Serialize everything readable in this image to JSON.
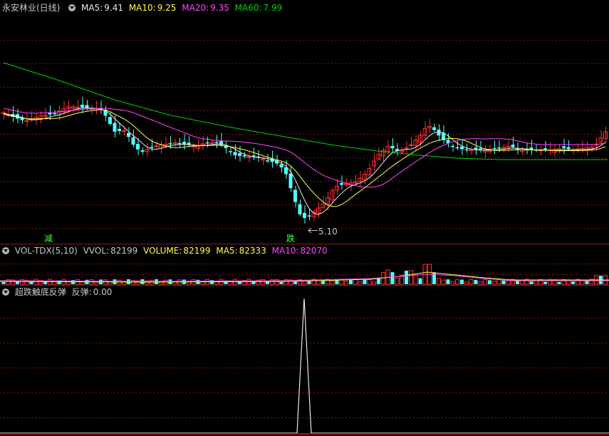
{
  "main_header": {
    "stock_label": "永安林业(日线)",
    "ma5_label": "MA5:",
    "ma5_value": "9.41",
    "ma10_label": "MA10:",
    "ma10_value": "9.25",
    "ma20_label": "MA20:",
    "ma20_value": "9.35",
    "ma60_label": "MA60:",
    "ma60_value": "7.99"
  },
  "vol_header": {
    "indicator_label": "VOL-TDX(5,10)",
    "vvol_label": "VVOL:",
    "vvol_value": "82199",
    "volume_label": "VOLUME:",
    "volume_value": "82199",
    "ma5_label": "MA5:",
    "ma5_value": "82333",
    "ma10_label": "MA10:",
    "ma10_value": "82070"
  },
  "sub_header": {
    "indicator_label": "超跌触底反弹",
    "value_label": "反弹:",
    "value": "0.00"
  },
  "annotations": {
    "marker_jian": "减",
    "marker_die": "跌",
    "low_price": "5.10"
  },
  "colors": {
    "up": "#ff3030",
    "down": "#54ffff",
    "ma5": "#e8e8e8",
    "ma10": "#ffff44",
    "ma20": "#ff44ff",
    "ma60": "#00d000",
    "grid": "#7a1010",
    "marker_text": "#44ff44"
  },
  "chart_data": {
    "type": "candlestick",
    "series": [
      {
        "name": "MA5",
        "last": 9.41
      },
      {
        "name": "MA10",
        "last": 9.25
      },
      {
        "name": "MA20",
        "last": 9.35
      },
      {
        "name": "MA60",
        "last": 7.99
      }
    ],
    "annotations": [
      {
        "text": "5.10",
        "meaning": "period low"
      }
    ]
  }
}
